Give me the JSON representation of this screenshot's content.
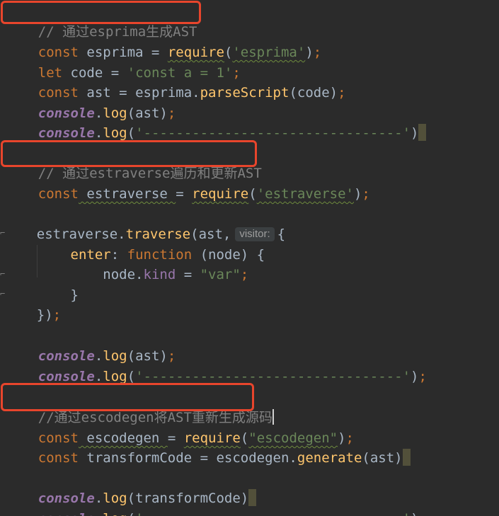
{
  "colors": {
    "background": "#2b2b2b",
    "keyword": "#cc7832",
    "string": "#6a8759",
    "comment": "#808080",
    "function": "#ffc66d",
    "property": "#9876aa",
    "text": "#a9b7c6",
    "annotation_box": "#e8452c"
  },
  "code": {
    "l1": {
      "comment": "// 通过esprima生成AST"
    },
    "l2": {
      "kw": "const",
      "name": " esprima ",
      "eq": "=",
      "sp": " ",
      "fn": "require",
      "open": "(",
      "str": "'esprima'",
      "close": ")",
      "semi": ";"
    },
    "l3": {
      "kw": "let",
      "name": " code ",
      "eq": "=",
      "sp": " ",
      "str": "'const a = 1'",
      "semi": ";"
    },
    "l4": {
      "kw": "const",
      "name": " ast ",
      "eq": "=",
      "sp": " ",
      "obj": "esprima",
      "dot": ".",
      "fn": "parseScript",
      "args": "(code)",
      "semi": ";"
    },
    "l5": {
      "console": "console",
      "dot": ".",
      "fn": "log",
      "args": "(ast)",
      "semi": ";"
    },
    "l6": {
      "console": "console",
      "dot": ".",
      "fn": "log",
      "open": "(",
      "str": "'--------------------------------'",
      "close": ")"
    },
    "l8": {
      "comment": "// 通过estraverse遍历和更新AST"
    },
    "l9": {
      "kw": "const",
      "name": " estraverse ",
      "eq": "=",
      "sp": " ",
      "fn": "require",
      "open": "(",
      "str": "'estraverse'",
      "close": ")",
      "semi": ";"
    },
    "l11": {
      "obj": "estraverse",
      "dot": ".",
      "fn": "traverse",
      "args": "(ast,",
      "hint": "visitor:",
      "brace": "{"
    },
    "l12": {
      "indent": "    ",
      "prop": "enter",
      "colon": ": ",
      "kw": "function",
      "args": " (node) {"
    },
    "l13": {
      "indent": "        ",
      "obj": "node",
      "dot": ".",
      "prop": "kind",
      "eq": " = ",
      "str": "\"var\"",
      "semi": ";"
    },
    "l14": {
      "indent": "    ",
      "brace": "}"
    },
    "l15": {
      "brace": "})",
      "semi": ";"
    },
    "l17": {
      "console": "console",
      "dot": ".",
      "fn": "log",
      "args": "(ast)",
      "semi": ";"
    },
    "l18": {
      "console": "console",
      "dot": ".",
      "fn": "log",
      "open": "(",
      "str": "'--------------------------------'",
      "close": ")",
      "semi": ";"
    },
    "l20": {
      "comment": "//通过escodegen将AST重新生成源码"
    },
    "l21": {
      "kw": "const",
      "name": " escodegen ",
      "eq": "=",
      "sp": " ",
      "fn": "require",
      "open": "(",
      "str": "\"escodegen\"",
      "close": ")",
      "semi": ";"
    },
    "l22": {
      "kw": "const",
      "name": " transformCode ",
      "eq": "=",
      "sp": " ",
      "obj": "escodegen",
      "dot": ".",
      "fn": "generate",
      "args": "(ast)"
    },
    "l24": {
      "console": "console",
      "dot": ".",
      "fn": "log",
      "args": "(transformCode)"
    },
    "l25": {
      "console": "console",
      "dot": ".",
      "fn": "log",
      "open": "(",
      "str": "'--------------------------------'",
      "close": ")",
      "semi": ";"
    }
  }
}
